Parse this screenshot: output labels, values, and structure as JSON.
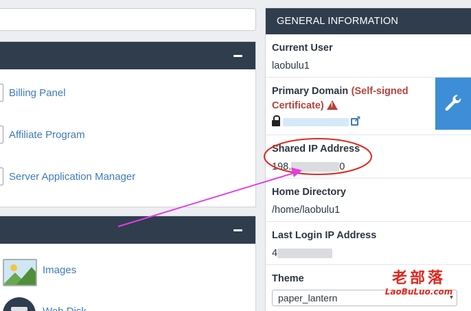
{
  "left": {
    "preferences_items": [
      {
        "label": "Billing Panel"
      },
      {
        "label": "Affiliate Program"
      },
      {
        "label": "Server Application Manager"
      }
    ],
    "files_items": [
      {
        "label": "Images",
        "icon": "images-icon"
      },
      {
        "label": "Web Disk",
        "icon": "web-disk-icon"
      }
    ]
  },
  "info": {
    "header": "GENERAL INFORMATION",
    "current_user_label": "Current User",
    "current_user_value": "laobulu1",
    "primary_domain_label": "Primary Domain",
    "primary_domain_warning": "(Self-signed Certificate)",
    "shared_ip_label": "Shared IP Address",
    "shared_ip_prefix": "198.",
    "shared_ip_suffix": "0",
    "home_dir_label": "Home Directory",
    "home_dir_value": "/home/laobulu1",
    "last_login_label": "Last Login IP Address",
    "last_login_prefix": "4",
    "theme_label": "Theme",
    "theme_value": "paper_lantern"
  },
  "watermark": {
    "cn": "老部落",
    "en": "LaoBuLuo.com"
  },
  "colors": {
    "header_bg": "#2f3d4d",
    "link": "#3e7ab8",
    "warning": "#b5423a",
    "tile": "#3d8ed6",
    "annotation": "#e2271d",
    "arrow": "#e53be7"
  }
}
